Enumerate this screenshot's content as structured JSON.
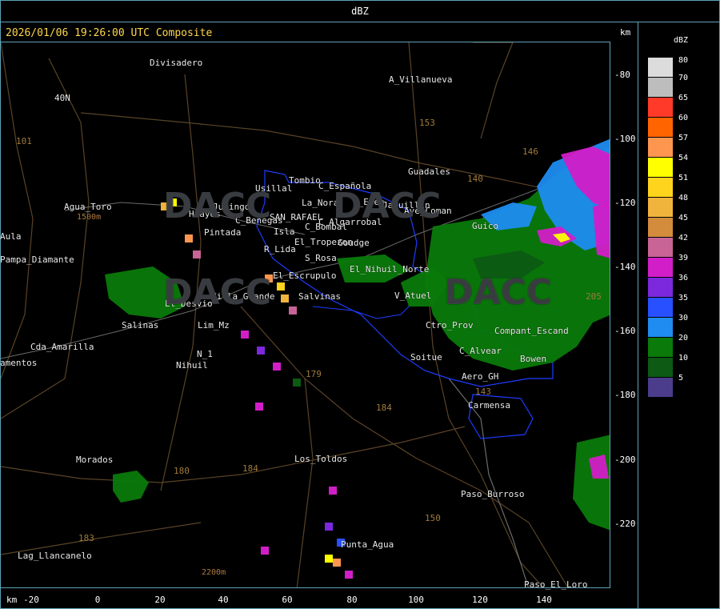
{
  "window": {
    "title": "dBZ"
  },
  "product": {
    "timestamp_label": "2026/01/06 19:26:00 UTC Composite"
  },
  "axes": {
    "unit_label": "km",
    "x_ticks": [
      "-20",
      "0",
      "20",
      "40",
      "60",
      "80",
      "100",
      "120",
      "140"
    ],
    "y_ticks": [
      "-80",
      "-100",
      "-120",
      "-140",
      "-160",
      "-180",
      "-200",
      "-220"
    ]
  },
  "legend": {
    "unit": "dBZ",
    "levels": [
      {
        "value": "80",
        "color": "#dcdcdc"
      },
      {
        "value": "70",
        "color": "#bdbdbd"
      },
      {
        "value": "65",
        "color": "#ff3a28"
      },
      {
        "value": "60",
        "color": "#ff6400"
      },
      {
        "value": "57",
        "color": "#ff9650"
      },
      {
        "value": "54",
        "color": "#ffff00"
      },
      {
        "value": "51",
        "color": "#ffd41c"
      },
      {
        "value": "48",
        "color": "#f0b43c"
      },
      {
        "value": "45",
        "color": "#d28c3c"
      },
      {
        "value": "42",
        "color": "#c86496"
      },
      {
        "value": "39",
        "color": "#d21ec8"
      },
      {
        "value": "36",
        "color": "#7c28dc"
      },
      {
        "value": "35",
        "color": "#2850ff"
      },
      {
        "value": "30",
        "color": "#1e8cf0"
      },
      {
        "value": "20",
        "color": "#0a7a0a"
      },
      {
        "value": "10",
        "color": "#0c5a14"
      },
      {
        "value": "5",
        "color": "#4b3c8c"
      }
    ]
  },
  "places": [
    "Divisadero",
    "A_Villanueva",
    "40N",
    "101",
    "Usillal",
    "Tombio",
    "C_Española",
    "La_Nora",
    "C_Epen",
    "Jaquillin",
    "Ave_Coman",
    "Guadales",
    "Agua_Toro",
    "Huayos",
    "Jumingo",
    "SAN_RAFAEL",
    "C_Benegas",
    "C_Algarrobal",
    "C_Bombal",
    "Pintada",
    "Isla",
    "El_Tropezon",
    "Goudge",
    "R_Lida",
    "S_Rosa",
    "El_Nihuil_Norte",
    "Guico",
    "Pampa_Diamante",
    "Aula",
    "El_Desvio",
    "Villa_Grande",
    "El_Escrupulo",
    "Salvinas",
    "V_Atuel",
    "Salinas",
    "Cda_Amarilla",
    "amentos",
    "N_1",
    "Nihuil",
    "Lim_Mz",
    "Ctro_Prov",
    "C_Alvear",
    "Compant_Escand",
    "Soitue",
    "Bowen",
    "Aero_GH",
    "Carmensa",
    "Morados",
    "Los_Toldos",
    "Paso_Burroso",
    "Punta_Agua",
    "Lag_Llancanelo",
    "Paso_El_Loro",
    "180",
    "184",
    "183",
    "150",
    "153",
    "146",
    "140",
    "143",
    "179",
    "205",
    "184",
    "2200m",
    "1500m",
    "DACC",
    "DACC",
    "DACC",
    "DACC"
  ]
}
